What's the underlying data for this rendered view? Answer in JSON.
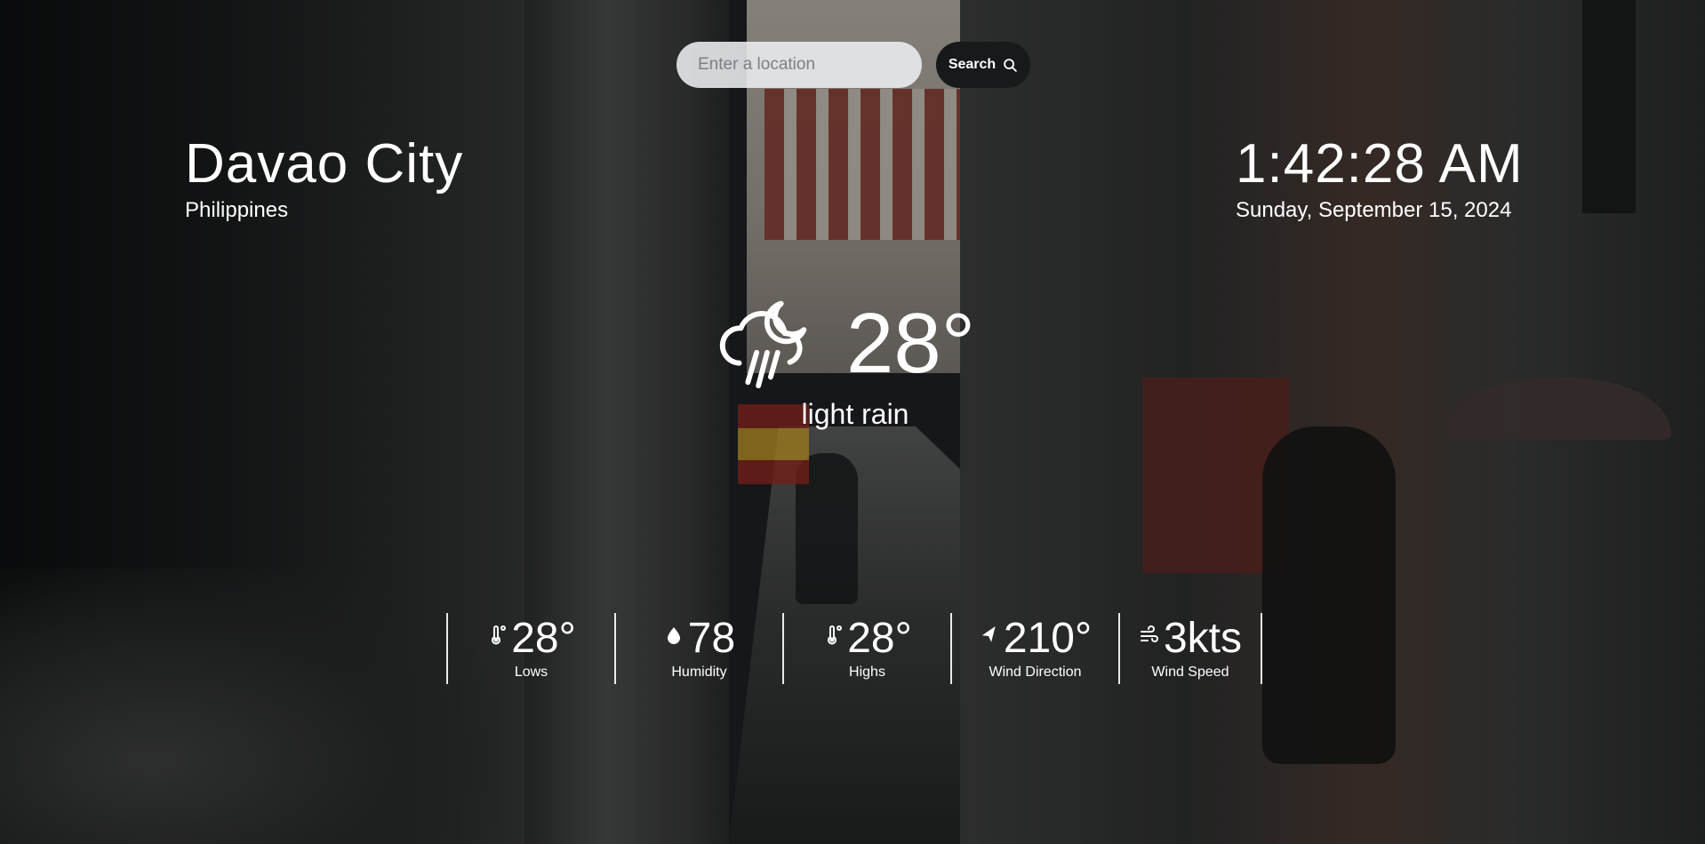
{
  "search": {
    "placeholder": "Enter a location",
    "button_label": "Search",
    "icon": "search-icon"
  },
  "location": {
    "city": "Davao City",
    "country": "Philippines"
  },
  "clock": {
    "time": "1:42:28 AM",
    "date": "Sunday, September 15, 2024"
  },
  "current": {
    "icon": "rain-cloud-moon-icon",
    "temperature": "28°",
    "description": "light rain"
  },
  "stats": [
    {
      "icon": "thermometer-icon",
      "value": "28°",
      "label": "Lows"
    },
    {
      "icon": "droplet-icon",
      "value": "78",
      "label": "Humidity"
    },
    {
      "icon": "thermometer-icon",
      "value": "28°",
      "label": "Highs"
    },
    {
      "icon": "navigation-arrow-icon",
      "value": "210°",
      "label": "Wind Direction"
    },
    {
      "icon": "wind-icon",
      "value": "3kts",
      "label": "Wind Speed"
    }
  ],
  "colors": {
    "text": "#ffffff",
    "search_field": "#eceef0",
    "search_button": "#17191b"
  }
}
